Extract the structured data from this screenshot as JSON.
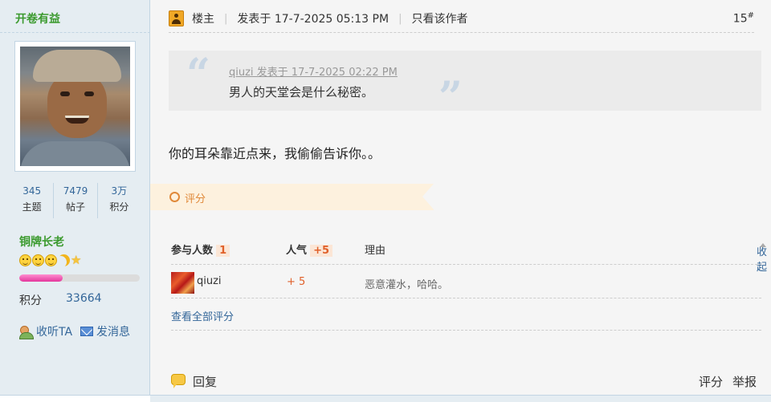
{
  "author": {
    "name": "开卷有益",
    "stats": [
      {
        "value": "345",
        "label": "主题"
      },
      {
        "value": "7479",
        "label": "帖子"
      },
      {
        "value": "3万",
        "label": "积分"
      }
    ],
    "rank": "铜牌长老",
    "level_icons": [
      "smile-icon",
      "smile-icon",
      "smile-icon",
      "moon-icon",
      "star-icon"
    ],
    "level_progress": 0.36,
    "credit_label": "积分",
    "credit_value": "33664",
    "follow_label": "收听TA",
    "message_label": "发消息"
  },
  "post": {
    "op_label": "楼主",
    "posted_at": "发表于 17-7-2025 05:13 PM",
    "only_author_label": "只看该作者",
    "floor": "15",
    "floor_mark": "#",
    "quote": {
      "author_line": "qiuzi 发表于 17-7-2025 02:22 PM",
      "text": "男人的天堂会是什么秘密。"
    },
    "body": "你的耳朵靠近点来，我偷偷告诉你。。"
  },
  "rating": {
    "tag_label": "评分",
    "participants_label": "参与人数",
    "participants_count": "1",
    "popularity_label": "人气",
    "popularity_value": "+5",
    "reason_label": "理由",
    "collapse_label": "收起",
    "rows": [
      {
        "user": "qiuzi",
        "score": "+ 5",
        "reason": "恶意灌水，哈哈。"
      }
    ],
    "view_all_label": "查看全部评分"
  },
  "footer": {
    "reply_label": "回复",
    "rate_label": "评分",
    "report_label": "举报"
  },
  "colors": {
    "sidebar_bg": "#e5edf2",
    "rank_green": "#3b9a2e",
    "link_blue": "#336699",
    "rate_orange": "#e0893a",
    "progress_pink": "#e3369c"
  }
}
